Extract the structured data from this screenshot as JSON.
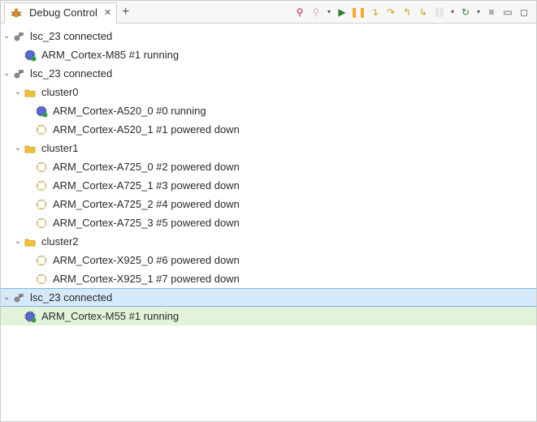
{
  "tab": {
    "title": "Debug Control"
  },
  "toolbar": {
    "connect": "Connect",
    "disconnect": "Disconnect",
    "run": "Run",
    "pause": "Pause",
    "step_into": "Step Into",
    "step_over": "Step Over",
    "step_out": "Step Out",
    "step_return": "Step Return",
    "link": "Link",
    "refresh": "Refresh",
    "view_menu": "View Menu",
    "minimize": "Minimize",
    "maximize": "Maximize"
  },
  "tree": [
    {
      "type": "connection",
      "label": "lsc_23 connected",
      "selected": false,
      "children": [
        {
          "type": "core",
          "label": "ARM_Cortex-M85 #1 running",
          "state": "running",
          "selected": false
        }
      ]
    },
    {
      "type": "connection",
      "label": "lsc_23 connected",
      "selected": false,
      "children": [
        {
          "type": "cluster",
          "label": "cluster0",
          "children": [
            {
              "type": "core",
              "label": "ARM_Cortex-A520_0 #0 running",
              "state": "running"
            },
            {
              "type": "core",
              "label": "ARM_Cortex-A520_1 #1 powered down",
              "state": "powered_down"
            }
          ]
        },
        {
          "type": "cluster",
          "label": "cluster1",
          "children": [
            {
              "type": "core",
              "label": "ARM_Cortex-A725_0 #2 powered down",
              "state": "powered_down"
            },
            {
              "type": "core",
              "label": "ARM_Cortex-A725_1 #3 powered down",
              "state": "powered_down"
            },
            {
              "type": "core",
              "label": "ARM_Cortex-A725_2 #4 powered down",
              "state": "powered_down"
            },
            {
              "type": "core",
              "label": "ARM_Cortex-A725_3 #5 powered down",
              "state": "powered_down"
            }
          ]
        },
        {
          "type": "cluster",
          "label": "cluster2",
          "children": [
            {
              "type": "core",
              "label": "ARM_Cortex-X925_0 #6 powered down",
              "state": "powered_down"
            },
            {
              "type": "core",
              "label": "ARM_Cortex-X925_1 #7 powered down",
              "state": "powered_down"
            }
          ]
        }
      ]
    },
    {
      "type": "connection",
      "label": "lsc_23 connected",
      "selected": true,
      "children": [
        {
          "type": "core",
          "label": "ARM_Cortex-M55 #1 running",
          "state": "running",
          "selected": true
        }
      ]
    }
  ]
}
